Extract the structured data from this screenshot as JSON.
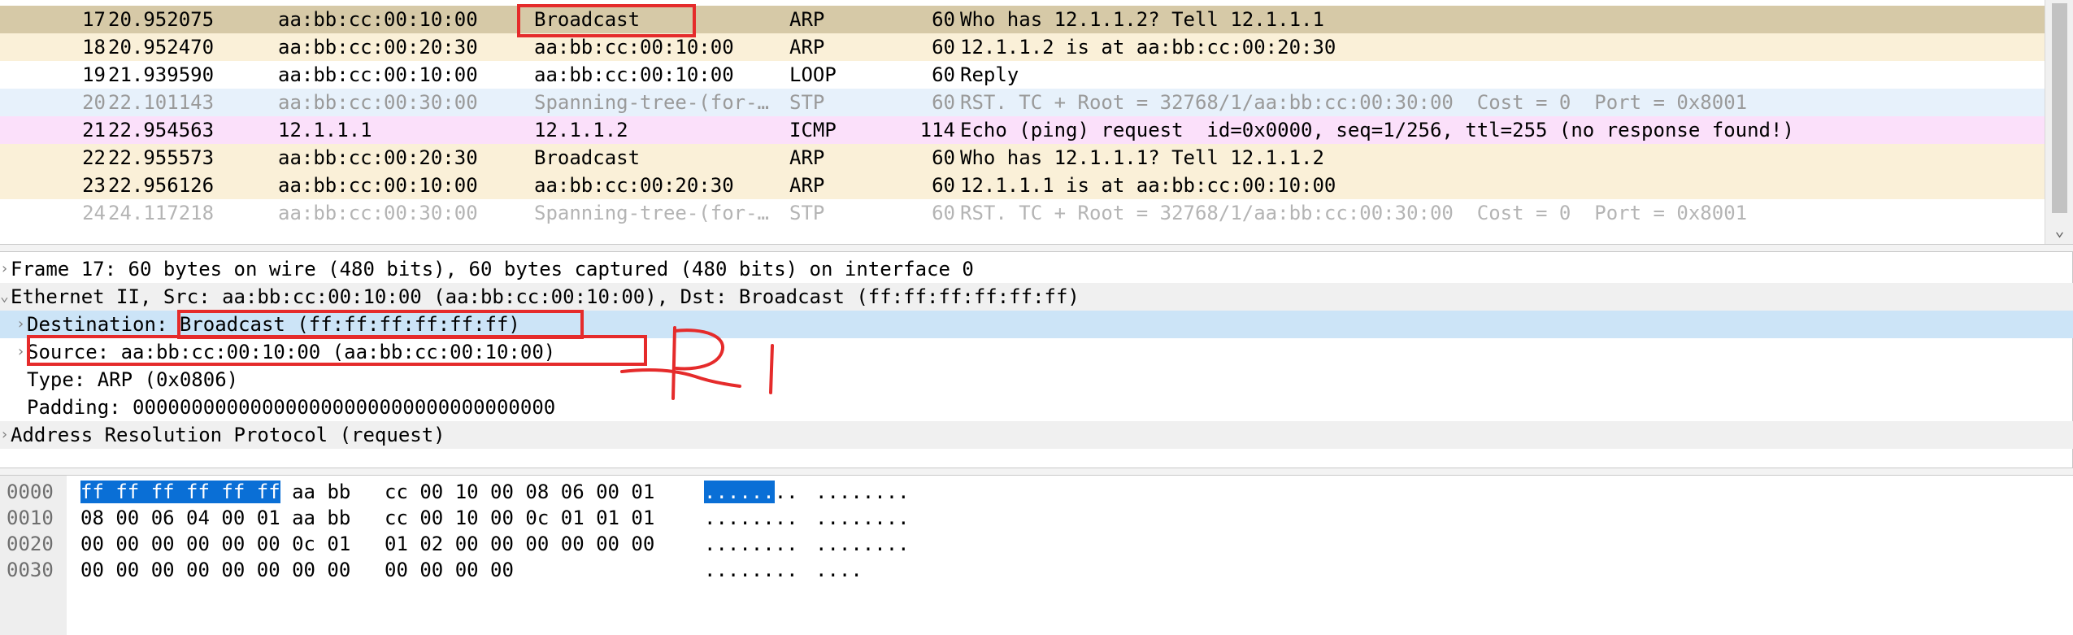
{
  "packets": [
    {
      "no": "17",
      "time": "20.952075",
      "src": "aa:bb:cc:00:10:00",
      "dst": "Broadcast",
      "proto": "ARP",
      "len": "60",
      "info": "Who has 12.1.1.2? Tell 12.1.1.1",
      "bg": "#d6c9a7",
      "fg": "#000000"
    },
    {
      "no": "18",
      "time": "20.952470",
      "src": "aa:bb:cc:00:20:30",
      "dst": "aa:bb:cc:00:10:00",
      "proto": "ARP",
      "len": "60",
      "info": "12.1.1.2 is at aa:bb:cc:00:20:30",
      "bg": "#faf0d8",
      "fg": "#000000"
    },
    {
      "no": "19",
      "time": "21.939590",
      "src": "aa:bb:cc:00:10:00",
      "dst": "aa:bb:cc:00:10:00",
      "proto": "LOOP",
      "len": "60",
      "info": "Reply",
      "bg": "#ffffff",
      "fg": "#000000"
    },
    {
      "no": "20",
      "time": "22.101143",
      "src": "aa:bb:cc:00:30:00",
      "dst": "Spanning-tree-(for-…",
      "proto": "STP",
      "len": "60",
      "info": "RST. TC + Root = 32768/1/aa:bb:cc:00:30:00  Cost = 0  Port = 0x8001",
      "bg": "#e7f1fb",
      "fg": "#9a9a9a"
    },
    {
      "no": "21",
      "time": "22.954563",
      "src": "12.1.1.1",
      "dst": "12.1.1.2",
      "proto": "ICMP",
      "len": "114",
      "info": "Echo (ping) request  id=0x0000, seq=1/256, ttl=255 (no response found!)",
      "bg": "#fbe0fa",
      "fg": "#000000"
    },
    {
      "no": "22",
      "time": "22.955573",
      "src": "aa:bb:cc:00:20:30",
      "dst": "Broadcast",
      "proto": "ARP",
      "len": "60",
      "info": "Who has 12.1.1.1? Tell 12.1.1.2",
      "bg": "#faf0d8",
      "fg": "#000000"
    },
    {
      "no": "23",
      "time": "22.956126",
      "src": "aa:bb:cc:00:10:00",
      "dst": "aa:bb:cc:00:20:30",
      "proto": "ARP",
      "len": "60",
      "info": "12.1.1.1 is at aa:bb:cc:00:10:00",
      "bg": "#faf0d8",
      "fg": "#000000"
    },
    {
      "no": "24",
      "time": "24.117218",
      "src": "aa:bb:cc:00:30:00",
      "dst": "Spanning-tree-(for-…",
      "proto": "STP",
      "len": "60",
      "info": "RST. TC + Root = 32768/1/aa:bb:cc:00:30:00  Cost = 0  Port = 0x8001",
      "bg": "#ffffff",
      "fg": "#b4b4b4"
    }
  ],
  "details": [
    {
      "text": "Frame 17: 60 bytes on wire (480 bits), 60 bytes captured (480 bits) on interface 0",
      "indent": 0,
      "arrow": "›",
      "selected": false
    },
    {
      "text": "Ethernet II, Src: aa:bb:cc:00:10:00 (aa:bb:cc:00:10:00), Dst: Broadcast (ff:ff:ff:ff:ff:ff)",
      "indent": 0,
      "arrow": "⌄",
      "selected": false
    },
    {
      "text": "Destination: Broadcast (ff:ff:ff:ff:ff:ff)",
      "indent": 1,
      "arrow": "›",
      "selected": true
    },
    {
      "text": "Source: aa:bb:cc:00:10:00 (aa:bb:cc:00:10:00)",
      "indent": 1,
      "arrow": "›",
      "selected": false
    },
    {
      "text": "Type: ARP (0x0806)",
      "indent": 1,
      "arrow": "",
      "selected": false
    },
    {
      "text": "Padding: 000000000000000000000000000000000000",
      "indent": 1,
      "arrow": "",
      "selected": false
    },
    {
      "text": "Address Resolution Protocol (request)",
      "indent": 0,
      "arrow": "›",
      "selected": false
    }
  ],
  "hex": [
    {
      "offset": "0000",
      "bytes_sel": "ff ff ff ff ff ff",
      "bytes_rest": " aa bb",
      "bytes2": "cc 00 10 00 08 06 00 01",
      "ascii_sel": "......",
      "ascii_rest": "..",
      "ascii2": "........"
    },
    {
      "offset": "0010",
      "bytes_sel": "",
      "bytes_rest": "08 00 06 04 00 01 aa bb",
      "bytes2": "cc 00 10 00 0c 01 01 01",
      "ascii_sel": "",
      "ascii_rest": "........",
      "ascii2": "........"
    },
    {
      "offset": "0020",
      "bytes_sel": "",
      "bytes_rest": "00 00 00 00 00 00 0c 01",
      "bytes2": "01 02 00 00 00 00 00 00",
      "ascii_sel": "",
      "ascii_rest": "........",
      "ascii2": "........"
    },
    {
      "offset": "0030",
      "bytes_sel": "",
      "bytes_rest": "00 00 00 00 00 00 00 00",
      "bytes2": "00 00 00 00",
      "ascii_sel": "",
      "ascii_rest": "........",
      "ascii2": "...."
    }
  ],
  "annotation": {
    "handwritten_text": "R1",
    "color": "#e52b2b"
  },
  "scrollbar": {
    "down_arrow": "⌄"
  }
}
